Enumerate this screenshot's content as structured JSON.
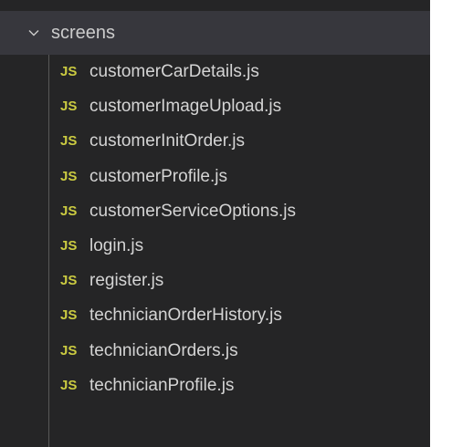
{
  "explorer": {
    "folder": {
      "name": "screens",
      "expanded": true
    },
    "file_icon_label": "JS",
    "files": [
      {
        "name": "customerCarDetails.js"
      },
      {
        "name": "customerImageUpload.js"
      },
      {
        "name": "customerInitOrder.js"
      },
      {
        "name": "customerProfile.js"
      },
      {
        "name": "customerServiceOptions.js"
      },
      {
        "name": "login.js"
      },
      {
        "name": "register.js"
      },
      {
        "name": "technicianOrderHistory.js"
      },
      {
        "name": "technicianOrders.js"
      },
      {
        "name": "technicianProfile.js"
      }
    ]
  },
  "colors": {
    "background": "#252526",
    "selected_row": "#37373d",
    "text": "#d4d4d4",
    "js_icon": "#cbcb41"
  }
}
